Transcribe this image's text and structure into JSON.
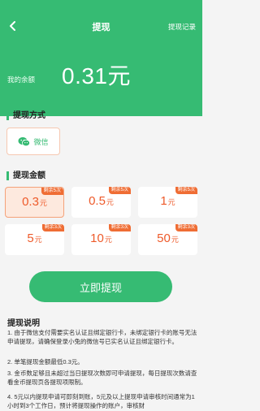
{
  "header": {
    "title": "提现",
    "record_label": "提现记录",
    "balance_label": "我的余额",
    "balance_value": "0.31元",
    "back_icon": "chevron-left-icon"
  },
  "method": {
    "section_title": "提现方式",
    "option_label": "微信",
    "option_icon": "wechat-icon"
  },
  "amount": {
    "section_title": "提现金额",
    "options": [
      {
        "value": "0.3",
        "unit": "元",
        "badge": "剩余5次",
        "selected": true
      },
      {
        "value": "0.5",
        "unit": "元",
        "badge": "剩余5次",
        "selected": false
      },
      {
        "value": "1",
        "unit": "元",
        "badge": "剩余5次",
        "selected": false
      },
      {
        "value": "5",
        "unit": "元",
        "badge": "剩余3次",
        "selected": false
      },
      {
        "value": "10",
        "unit": "元",
        "badge": "剩余3次",
        "selected": false
      },
      {
        "value": "50",
        "unit": "元",
        "badge": "剩余3次",
        "selected": false
      }
    ]
  },
  "submit_label": "立即提现",
  "notes": {
    "title": "提现说明",
    "items": [
      "1. 由于微信支付需要实名认证且绑定银行卡，未绑定银行卡的账号无法申请提现，请确保登录小兔的微信号已实名认证且绑定银行卡。",
      "2. 单笔提现金额最低0.3元。",
      "3. 金币数足够且未超过当日提现次数即可申请提现，每日提现次数请查看金币提现页各提现项限制。",
      "4. 5元以内提现申请可即刻到账，5元及以上提现申请审核时间通常为1小时到3个工作日，预计将提现操作的账户，审核财"
    ]
  },
  "colors": {
    "brand_green": "#36bb73",
    "accent_orange": "#ee5a2a",
    "badge_orange": "#ef6d34",
    "selected_bg": "#fde9de"
  }
}
